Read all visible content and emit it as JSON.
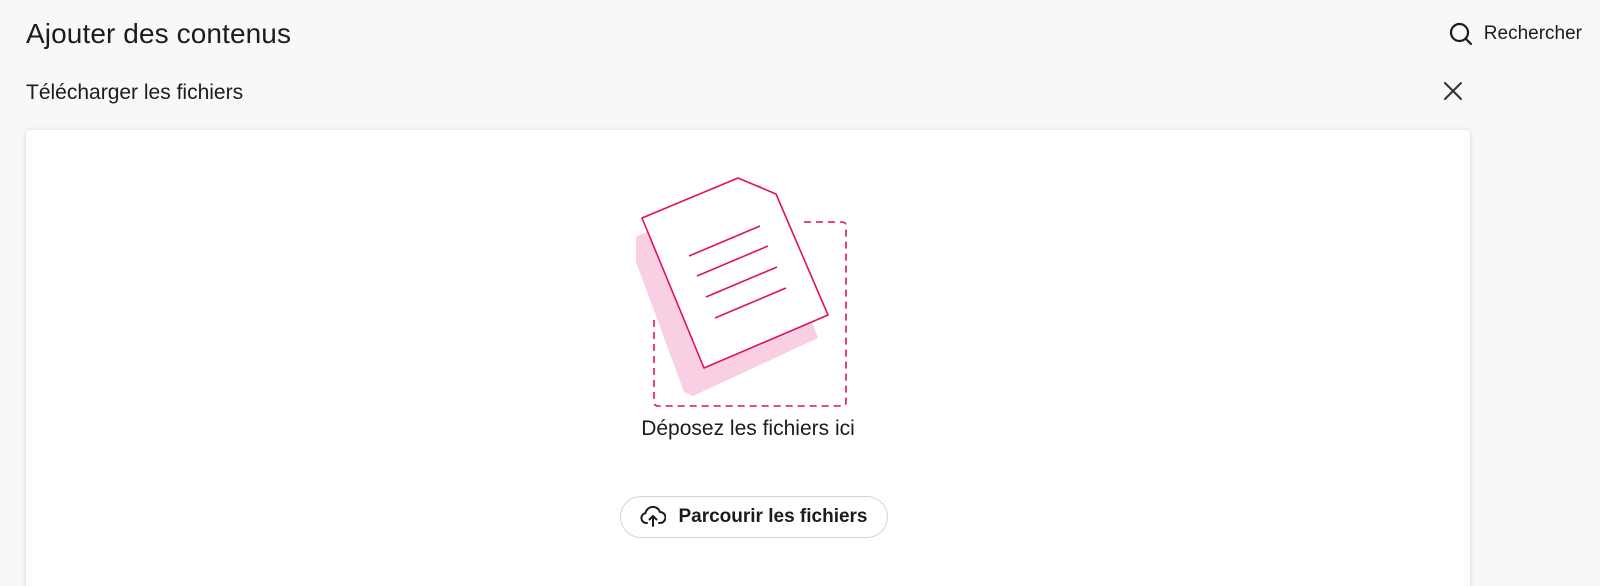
{
  "header": {
    "title": "Ajouter des contenus",
    "search_label": "Rechercher",
    "search_icon": "search-icon"
  },
  "upload": {
    "section_title": "Télécharger les fichiers",
    "close_icon": "close-icon",
    "drop_text": "Déposez les fichiers ici",
    "browse_label": "Parcourir les fichiers",
    "browse_icon": "cloud-upload-icon",
    "illustration_icon": "document-drop-illustration"
  },
  "colors": {
    "background": "#f8f8f8",
    "panel": "#ffffff",
    "accent": "#e0115f",
    "accent_light": "#f9cfe3",
    "text": "#1c1c1c",
    "border": "#d4d4d4"
  }
}
